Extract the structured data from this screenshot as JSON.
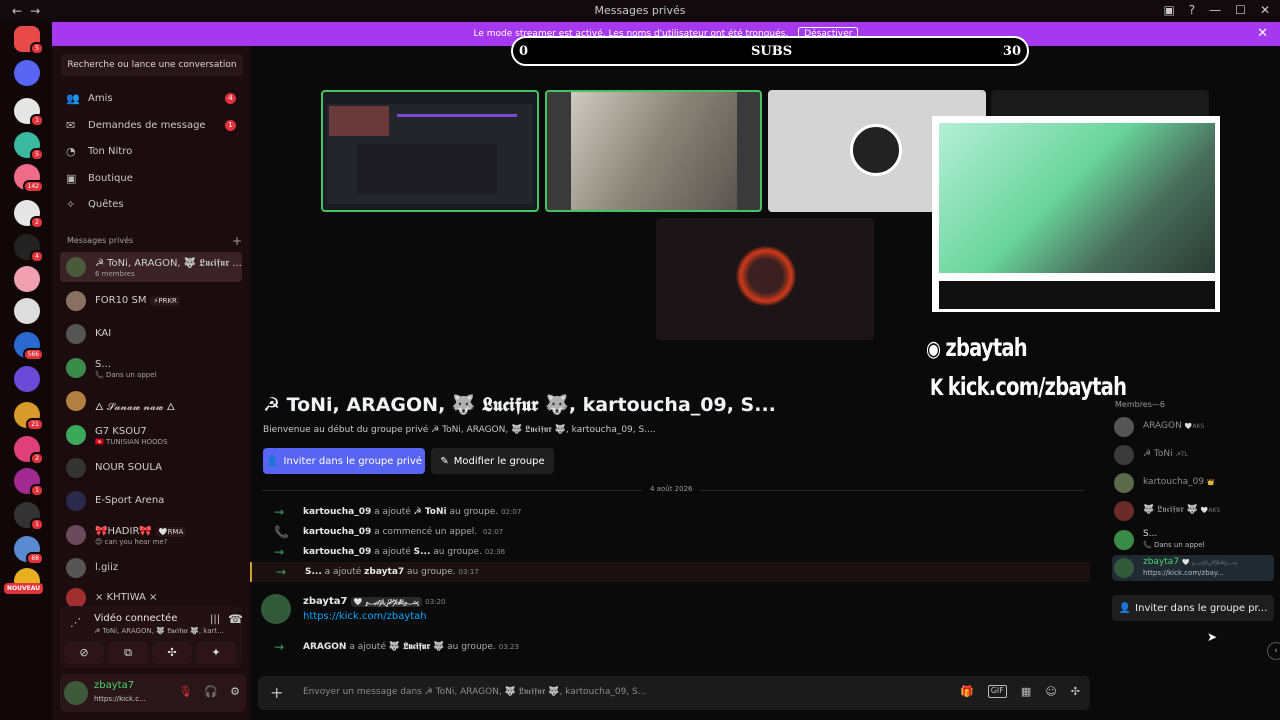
{
  "titlebar": {
    "title": "Messages privés",
    "back": "←",
    "forward": "→",
    "controls": [
      "▣",
      "?",
      "—",
      "☐",
      "✕"
    ]
  },
  "banner": {
    "text": "Le mode streamer est activé. Les noms d'utilisateur ont été tronqués.",
    "button": "Désactiver",
    "close": "✕"
  },
  "rail": {
    "servers": [
      {
        "badge": "5",
        "color": "#e84a4a"
      },
      {
        "badge": "",
        "color": "#5865f2"
      },
      {
        "badge": "1",
        "color": "#e6e6e6"
      },
      {
        "badge": "5",
        "color": "#3bb8a0"
      },
      {
        "badge": "142",
        "color": "#f06a8a"
      },
      {
        "badge": "2",
        "color": "#e6e6e6"
      },
      {
        "badge": "4",
        "color": "#222"
      },
      {
        "badge": "",
        "color": "#f0a0b0"
      },
      {
        "badge": "",
        "color": "#ddd"
      },
      {
        "badge": "566",
        "color": "#2a6ad0"
      },
      {
        "badge": "",
        "color": "#6b4ad8"
      },
      {
        "badge": "21",
        "color": "#d89a2a"
      },
      {
        "badge": "2",
        "color": "#e0407a"
      },
      {
        "badge": "1",
        "color": "#a02a90"
      },
      {
        "badge": "1",
        "color": "#333"
      },
      {
        "badge": "68",
        "color": "#5a8ad0"
      },
      {
        "badge": "",
        "color": "#e8b020"
      }
    ],
    "new_label": "NOUVEAU"
  },
  "sidebar": {
    "search": "Recherche ou lance une conversation",
    "nav": [
      {
        "label": "Amis",
        "icon": "👥",
        "badge": "4"
      },
      {
        "label": "Demandes de message",
        "icon": "✉",
        "badge": "1"
      },
      {
        "label": "Ton Nitro",
        "icon": "◔",
        "badge": ""
      },
      {
        "label": "Boutique",
        "icon": "▣",
        "badge": ""
      },
      {
        "label": "Quêtes",
        "icon": "✧",
        "badge": ""
      }
    ],
    "dm_header": "Messages privés",
    "dms": [
      {
        "name": "☭ ToNi, ARAGON, 🐺 𝕷𝖚𝖈𝖎𝖋𝖚𝖗 ...",
        "sub": "6 membres",
        "tag": "",
        "active": true,
        "color": "#4a5a3a"
      },
      {
        "name": "FOR10 SM",
        "sub": "",
        "tag": "⚡PRKR",
        "active": false,
        "color": "#8a7060"
      },
      {
        "name": "KAI",
        "sub": "",
        "tag": "",
        "active": false,
        "color": "#555"
      },
      {
        "name": "S...",
        "sub": "📞 Dans un appel",
        "tag": "",
        "active": false,
        "color": "#3a8a4a"
      },
      {
        "name": "🜂 𝓢𝓪𝓷𝓪𝔀 𝓷𝓪𝔀 🜂",
        "sub": "",
        "tag": "",
        "active": false,
        "color": "#b08040"
      },
      {
        "name": "G7 KSOU7",
        "sub": "🇹🇳 TUNISIAN HOODS",
        "tag": "",
        "active": false,
        "color": "#3aaa5a"
      },
      {
        "name": "NOUR SOULA",
        "sub": "",
        "tag": "",
        "active": false,
        "color": "#333"
      },
      {
        "name": "E-Sport Arena",
        "sub": "",
        "tag": "",
        "active": false,
        "color": "#2a2a4a"
      },
      {
        "name": "🎀HADIR🎀",
        "sub": "😊 can you hear me?",
        "tag": "🤍RMA",
        "active": false,
        "color": "#6a4a5a"
      },
      {
        "name": "l.giiz",
        "sub": "",
        "tag": "",
        "active": false,
        "color": "#555"
      },
      {
        "name": "× KHTIWA ×",
        "sub": "",
        "tag": "",
        "active": false,
        "color": "#a03030"
      }
    ]
  },
  "voice": {
    "title": "Vidéo connectée",
    "channel": "☭ ToNi, ARAGON, 🐺 𝕷𝖚𝖈𝖎𝖋𝖚𝖗 🐺, kart...",
    "buttons": [
      "⊘",
      "⧉",
      "✣",
      "✦"
    ]
  },
  "user": {
    "name": "zbayta7",
    "status": "https://kick.c...",
    "controls": [
      "🎙",
      "🎧",
      "⚙"
    ]
  },
  "stream_overlay": {
    "subs_label": "SUBS",
    "subs_min": "0",
    "subs_max": "30",
    "discord_handle": "zbaytah",
    "kick_handle": "kick.com/zbaytah"
  },
  "group": {
    "title": "☭ ToNi, ARAGON, 🐺 𝕷𝖚𝖈𝖎𝖋𝖚𝖗 🐺, kartoucha_09, S...",
    "welcome": "Bienvenue au début du groupe privé ☭ ToNi, ARAGON, 🐺 𝕷𝖚𝖈𝖎𝖋𝖚𝖗 🐺, kartoucha_09, S....",
    "invite_button": "Inviter dans le groupe privé",
    "edit_button": "Modifier le groupe"
  },
  "chat": {
    "date": "4 août 2026",
    "events": [
      {
        "icon": "→",
        "actor": "kartoucha_09",
        "verb": "a ajouté",
        "target": "☭ ToNi",
        "suffix": "au groupe.",
        "time": "02:07",
        "highlight": false
      },
      {
        "icon": "📞",
        "actor": "kartoucha_09",
        "verb": "a commencé un appel.",
        "target": "",
        "suffix": "",
        "time": "02:07",
        "highlight": false
      },
      {
        "icon": "→",
        "actor": "kartoucha_09",
        "verb": "a ajouté",
        "target": "S...",
        "suffix": "au groupe.",
        "time": "02:36",
        "highlight": false
      },
      {
        "icon": "→",
        "actor": "S...",
        "verb": "a ajouté",
        "target": "zbayta7",
        "suffix": "au groupe.",
        "time": "03:17",
        "highlight": true
      }
    ],
    "message": {
      "author": "zbayta7",
      "tag": "🤍 ﷽",
      "time": "03:20",
      "text": "https://kick.com/zbaytah"
    },
    "last_event": {
      "icon": "→",
      "actor": "ARAGON",
      "verb": "a ajouté",
      "target": "🐺 𝕷𝖚𝖈𝖎𝖋𝖚𝖗 🐺",
      "suffix": "au groupe.",
      "time": "03:23"
    }
  },
  "composer": {
    "placeholder": "Envoyer un message dans ☭ ToNi, ARAGON, 🐺 𝕷𝖚𝖈𝖎𝖋𝖚𝖗 🐺, kartoucha_09, S...",
    "tools": [
      "🎁",
      "GIF",
      "▦",
      "☺",
      "✣"
    ]
  },
  "members": {
    "header": "Membres—6",
    "list": [
      {
        "name": "ARAGON",
        "tag": "🤍AKS",
        "sub": "",
        "color": "#555"
      },
      {
        "name": "☭ ToNi",
        "tag": "☭TL",
        "sub": "",
        "color": "#3a3a3a"
      },
      {
        "name": "kartoucha_09",
        "tag": "👑",
        "sub": "",
        "color": "#5a6a4a"
      },
      {
        "name": "🐺 𝕷𝖚𝖈𝖎𝖋𝖚𝖗 🐺",
        "tag": "🤍AKS",
        "sub": "",
        "color": "#6a2a2a"
      },
      {
        "name": "S...",
        "tag": "",
        "sub": "📞 Dans un appel",
        "color": "#3a8a4a"
      },
      {
        "name": "zbayta7",
        "tag": "🤍 ﷽",
        "sub": "https://kick.com/zbay...",
        "color": "#33593b"
      }
    ],
    "invite_button": "Inviter dans le groupe pr..."
  }
}
